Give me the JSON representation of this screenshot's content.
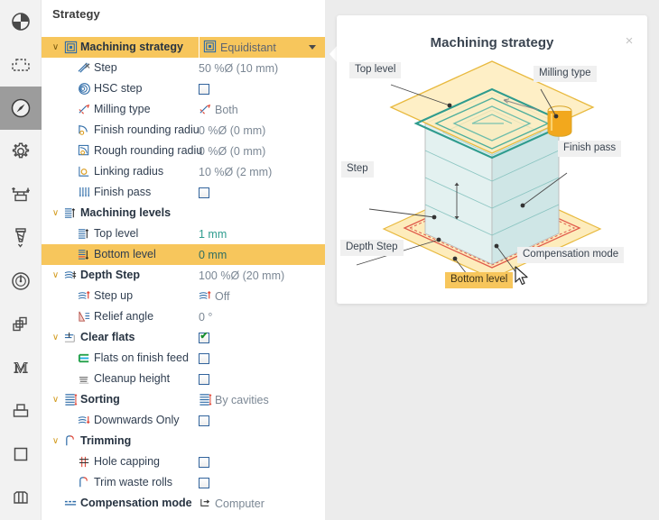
{
  "rail": {
    "items": [
      {
        "name": "job-icon",
        "label": "Job",
        "active": false
      },
      {
        "name": "stock-icon",
        "label": "Stock",
        "active": false
      },
      {
        "name": "strategy-icon",
        "label": "Strategy",
        "active": true
      },
      {
        "name": "settings-icon",
        "label": "Settings",
        "active": false
      },
      {
        "name": "clamping-icon",
        "label": "Clamping",
        "active": false
      },
      {
        "name": "tool-icon",
        "label": "Tool",
        "active": false
      },
      {
        "name": "feeds-icon",
        "label": "Feeds & speeds",
        "active": false
      },
      {
        "name": "layers-icon",
        "label": "Layers",
        "active": false
      },
      {
        "name": "macro-icon",
        "label": "Macro",
        "active": false
      },
      {
        "name": "geometry-icon",
        "label": "Geometry",
        "active": false
      },
      {
        "name": "surface-icon",
        "label": "Surface",
        "active": false
      },
      {
        "name": "columns-icon",
        "label": "Columns",
        "active": false
      }
    ]
  },
  "panel": {
    "title": "Strategy"
  },
  "tree": {
    "rows": [
      {
        "label": "Machining strategy",
        "value": "Equidistant",
        "type": "dropdown",
        "indent": 0,
        "bold": true,
        "twisty": "v",
        "icon": "strategy-spiral-icon",
        "value_icon": "strategy-spiral-icon",
        "selected": true
      },
      {
        "label": "Step",
        "value": "50 %Ø (10 mm)",
        "type": "text",
        "indent": 1,
        "bold": false,
        "twisty": "",
        "icon": "step-icon",
        "value_icon": "",
        "selected": false
      },
      {
        "label": "HSC step",
        "value": "",
        "type": "checkbox",
        "indent": 1,
        "bold": false,
        "twisty": "",
        "icon": "hsc-step-icon",
        "checked": false,
        "selected": false
      },
      {
        "label": "Milling type",
        "value": "Both",
        "type": "text",
        "indent": 1,
        "bold": false,
        "twisty": "",
        "icon": "milling-type-icon",
        "value_icon": "milling-type-icon",
        "selected": false
      },
      {
        "label": "Finish rounding radiu",
        "value": "0 %Ø (0 mm)",
        "type": "text",
        "indent": 1,
        "bold": false,
        "twisty": "",
        "icon": "finish-rounding-icon",
        "value_icon": "",
        "selected": false
      },
      {
        "label": "Rough rounding radiu",
        "value": "0 %Ø (0 mm)",
        "type": "text",
        "indent": 1,
        "bold": false,
        "twisty": "",
        "icon": "rough-rounding-icon",
        "value_icon": "",
        "selected": false
      },
      {
        "label": "Linking radius",
        "value": "10 %Ø (2 mm)",
        "type": "text",
        "indent": 1,
        "bold": false,
        "twisty": "",
        "icon": "linking-radius-icon",
        "value_icon": "",
        "selected": false
      },
      {
        "label": "Finish pass",
        "value": "",
        "type": "checkbox",
        "indent": 1,
        "bold": false,
        "twisty": "",
        "icon": "finish-pass-icon",
        "checked": false,
        "selected": false
      },
      {
        "label": "Machining levels",
        "value": "",
        "type": "none",
        "indent": 0,
        "bold": true,
        "twisty": "v",
        "icon": "machining-levels-icon",
        "value_icon": "",
        "selected": false
      },
      {
        "label": "Top level",
        "value": "1 mm",
        "type": "teal",
        "indent": 1,
        "bold": false,
        "twisty": "",
        "icon": "top-level-icon",
        "value_icon": "",
        "selected": false
      },
      {
        "label": "Bottom level",
        "value": "0 mm",
        "type": "teal",
        "indent": 1,
        "bold": false,
        "twisty": "",
        "icon": "bottom-level-icon",
        "value_icon": "",
        "selected": true
      },
      {
        "label": "Depth Step",
        "value": "100 %Ø (20 mm)",
        "type": "text",
        "indent": 0,
        "bold": true,
        "twisty": "v",
        "icon": "depth-step-icon",
        "value_icon": "",
        "selected": false
      },
      {
        "label": "Step up",
        "value": "Off",
        "type": "text",
        "indent": 1,
        "bold": false,
        "twisty": "",
        "icon": "step-up-icon",
        "value_icon": "step-up-icon",
        "selected": false
      },
      {
        "label": "Relief angle",
        "value": "0 °",
        "type": "text",
        "indent": 1,
        "bold": false,
        "twisty": "",
        "icon": "relief-angle-icon",
        "value_icon": "",
        "selected": false
      },
      {
        "label": "Clear flats",
        "value": "",
        "type": "checkbox",
        "indent": 0,
        "bold": true,
        "twisty": "v",
        "icon": "clear-flats-icon",
        "checked": true,
        "selected": false
      },
      {
        "label": "Flats on finish feed",
        "value": "",
        "type": "checkbox",
        "indent": 1,
        "bold": false,
        "twisty": "",
        "icon": "flats-finish-feed-icon",
        "checked": false,
        "selected": false
      },
      {
        "label": "Cleanup height",
        "value": "",
        "type": "checkbox",
        "indent": 1,
        "bold": false,
        "twisty": "",
        "icon": "cleanup-height-icon",
        "checked": false,
        "selected": false
      },
      {
        "label": "Sorting",
        "value": "By cavities",
        "type": "text",
        "indent": 0,
        "bold": true,
        "twisty": "v",
        "icon": "sorting-icon",
        "value_icon": "sorting-icon",
        "selected": false
      },
      {
        "label": "Downwards Only",
        "value": "",
        "type": "checkbox",
        "indent": 1,
        "bold": false,
        "twisty": "",
        "icon": "downwards-only-icon",
        "checked": false,
        "selected": false
      },
      {
        "label": "Trimming",
        "value": "",
        "type": "none",
        "indent": 0,
        "bold": true,
        "twisty": "v",
        "icon": "trimming-icon",
        "value_icon": "",
        "selected": false
      },
      {
        "label": "Hole capping",
        "value": "",
        "type": "checkbox",
        "indent": 1,
        "bold": false,
        "twisty": "",
        "icon": "hole-capping-icon",
        "checked": false,
        "selected": false
      },
      {
        "label": "Trim waste rolls",
        "value": "",
        "type": "checkbox",
        "indent": 1,
        "bold": false,
        "twisty": "",
        "icon": "trim-waste-rolls-icon",
        "checked": false,
        "selected": false
      },
      {
        "label": "Compensation mode",
        "value": "Computer",
        "type": "text",
        "indent": 0,
        "bold": true,
        "twisty": "",
        "icon": "compensation-mode-icon",
        "value_icon": "compensation-mode-icon",
        "selected": false
      }
    ]
  },
  "popup": {
    "title": "Machining strategy",
    "close_label": "×",
    "callouts": [
      {
        "key": "top_level",
        "label": "Top level",
        "highlight": false
      },
      {
        "key": "milling_type",
        "label": "Milling type",
        "highlight": false
      },
      {
        "key": "step",
        "label": "Step",
        "highlight": false
      },
      {
        "key": "finish_pass",
        "label": "Finish pass",
        "highlight": false
      },
      {
        "key": "depth_step",
        "label": "Depth Step",
        "highlight": false
      },
      {
        "key": "compensation",
        "label": "Compensation mode",
        "highlight": false
      },
      {
        "key": "bottom_level",
        "label": "Bottom level",
        "highlight": true
      }
    ]
  },
  "colors": {
    "selection": "#f7c65c",
    "plane_fill": "#fde9b0",
    "plane_stroke": "#e8b93e",
    "toolpath": "#2f9c8e",
    "block_face": "#dff0ef",
    "block_side": "#cfe6e6",
    "compensation": "#e05a4b",
    "tool": "#f2a81d",
    "rail_active": "#9c9c9c"
  }
}
